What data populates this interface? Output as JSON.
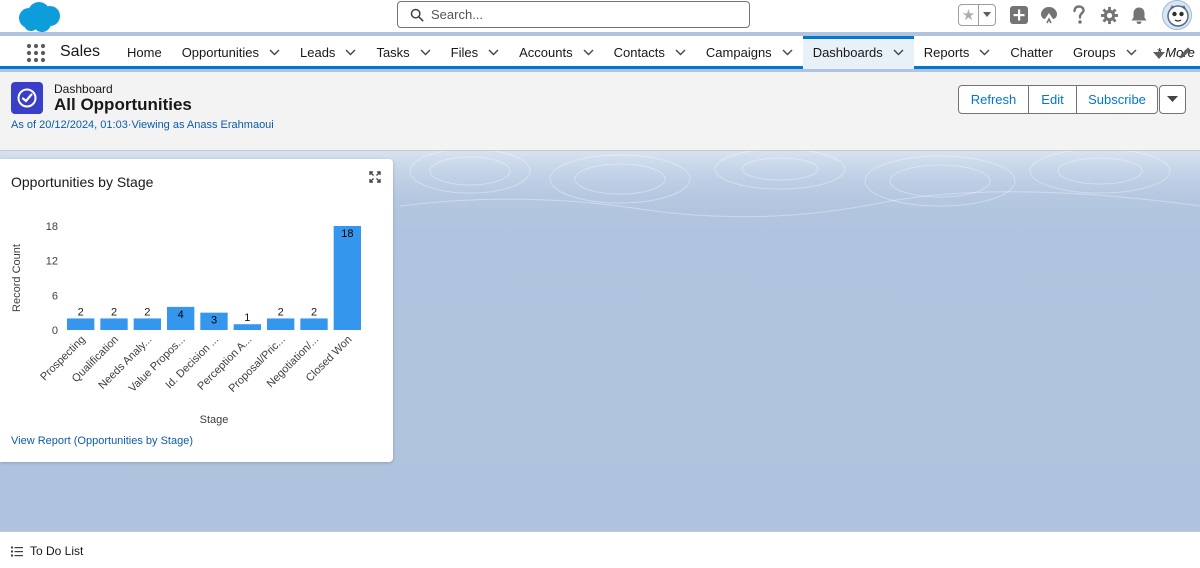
{
  "header": {
    "search": {
      "placeholder": "Search...",
      "value": ""
    },
    "icons": [
      "favorites-star-icon",
      "add-icon",
      "trailhead-icon",
      "help-icon",
      "setup-gear-icon",
      "notifications-bell-icon",
      "avatar"
    ]
  },
  "nav": {
    "app_name": "Sales",
    "items": [
      {
        "label": "Home",
        "has_menu": false,
        "active": false
      },
      {
        "label": "Opportunities",
        "has_menu": true,
        "active": false
      },
      {
        "label": "Leads",
        "has_menu": true,
        "active": false
      },
      {
        "label": "Tasks",
        "has_menu": true,
        "active": false
      },
      {
        "label": "Files",
        "has_menu": true,
        "active": false
      },
      {
        "label": "Accounts",
        "has_menu": true,
        "active": false
      },
      {
        "label": "Contacts",
        "has_menu": true,
        "active": false
      },
      {
        "label": "Campaigns",
        "has_menu": true,
        "active": false
      },
      {
        "label": "Dashboards",
        "has_menu": true,
        "active": true
      },
      {
        "label": "Reports",
        "has_menu": true,
        "active": false
      },
      {
        "label": "Chatter",
        "has_menu": false,
        "active": false
      },
      {
        "label": "Groups",
        "has_menu": true,
        "active": false
      },
      {
        "label": "* More",
        "has_menu": true,
        "active": false
      }
    ]
  },
  "page_header": {
    "kicker": "Dashboard",
    "title": "All Opportunities",
    "meta": "As of 20/12/2024, 01:03·Viewing as Anass Erahmaoui",
    "buttons": {
      "refresh": "Refresh",
      "edit": "Edit",
      "subscribe": "Subscribe"
    }
  },
  "card": {
    "title": "Opportunities by Stage",
    "link": "View Report (Opportunities by Stage)"
  },
  "chart_data": {
    "type": "bar",
    "categories": [
      "Prospecting",
      "Qualification",
      "Needs Analy...",
      "Value Propos...",
      "Id. Decision ...",
      "Perception A...",
      "Proposal/Pric...",
      "Negotiation/...",
      "Closed Won"
    ],
    "values": [
      2,
      2,
      2,
      4,
      3,
      1,
      2,
      2,
      18
    ],
    "xlabel": "Stage",
    "ylabel": "Record Count",
    "yticks": [
      0,
      6,
      12,
      18
    ],
    "ylim": [
      0,
      18
    ],
    "bar_color": "#3496ec",
    "grid": false
  },
  "footer": {
    "todo_label": "To Do List"
  },
  "colors": {
    "brand": "#0176d3",
    "dashboard_bg": "#b0c4df",
    "icon_bg": "#3a3fc7"
  }
}
